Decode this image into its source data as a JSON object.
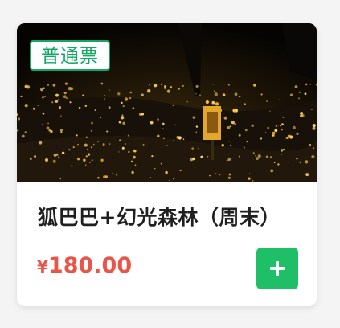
{
  "ticket_card": {
    "badge_label": "普通票",
    "title": "狐巴巴+幻光森林（周末）",
    "currency_symbol": "¥",
    "price": "180.00",
    "add_button_icon": "plus-icon",
    "photo_subject": "night forest with glowing firefly lights"
  },
  "colors": {
    "badge_green": "#0fa963",
    "price_red": "#e8564a",
    "button_green": "#1fbf68"
  }
}
